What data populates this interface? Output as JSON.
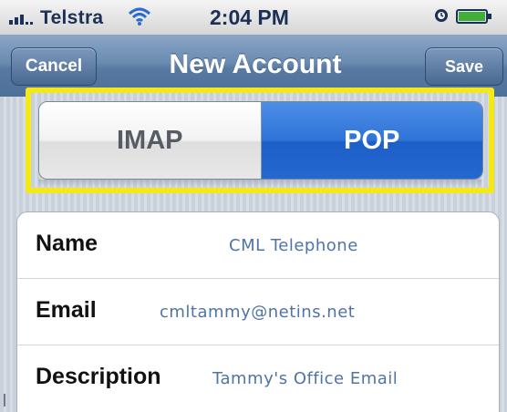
{
  "status_bar": {
    "carrier": "Telstra",
    "time": "2:04 PM",
    "icons": [
      "signal-icon",
      "wifi-icon",
      "clock-icon",
      "battery-icon"
    ]
  },
  "nav": {
    "title": "New Account",
    "cancel_label": "Cancel",
    "save_label": "Save"
  },
  "segments": {
    "options": [
      "IMAP",
      "POP"
    ],
    "selected": "POP"
  },
  "form": {
    "rows": [
      {
        "label": "Name",
        "value": "CML Telephone"
      },
      {
        "label": "Email",
        "value": "cmltammy@netins.net"
      },
      {
        "label": "Description",
        "value": "Tammy's Office Email"
      }
    ]
  },
  "colors": {
    "highlight": "#f3e81a",
    "selected_segment": "#2f73d8",
    "nav_bar": "#6a8bb0",
    "field_value": "#4f74a6"
  }
}
